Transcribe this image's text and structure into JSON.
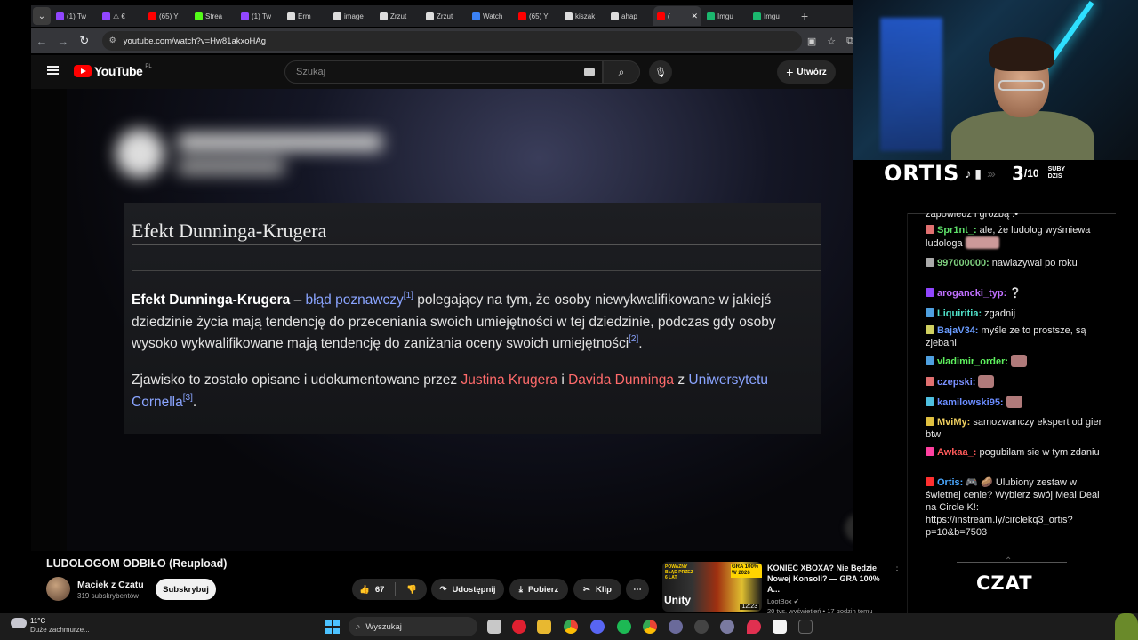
{
  "browser": {
    "tabs": [
      {
        "label": "(1) Tw",
        "color": "#9146ff"
      },
      {
        "label": "⚠ €",
        "color": "#9146ff"
      },
      {
        "label": "(65) Y",
        "color": "#ff0000"
      },
      {
        "label": "Strea",
        "color": "#53fc18"
      },
      {
        "label": "(1) Tw",
        "color": "#9146ff"
      },
      {
        "label": "Erm",
        "color": "#dddddd"
      },
      {
        "label": "image",
        "color": "#dddddd"
      },
      {
        "label": "Zrzut",
        "color": "#dddddd"
      },
      {
        "label": "Zrzut",
        "color": "#dddddd"
      },
      {
        "label": "Watch",
        "color": "#3b82f6"
      },
      {
        "label": "(65) Y",
        "color": "#ff0000"
      },
      {
        "label": "kiszak",
        "color": "#dddddd"
      },
      {
        "label": "ahap",
        "color": "#dddddd"
      },
      {
        "label": "(",
        "color": "#ff0000",
        "active": true
      },
      {
        "label": "Imgu",
        "color": "#1bb76e"
      },
      {
        "label": "Imgu",
        "color": "#1bb76e"
      }
    ],
    "url": "youtube.com/watch?v=Hw81akxoHAg"
  },
  "youtube": {
    "logo_text": "YouTube",
    "country": "PL",
    "search_placeholder": "Szukaj",
    "create_label": "Utwórz"
  },
  "video_frame": {
    "article_title": "Efekt Dunninga-Krugera",
    "p1": {
      "term": "Efekt Dunninga-Krugera",
      "dash": " – ",
      "link1": "błąd poznawczy",
      "ref1": "[1]",
      "text1": " polegający na tym, że osoby niewykwalifikowane w jakiejś dziedzinie życia mają tendencję do przeceniania swoich umiejętności w tej dziedzinie, podczas gdy osoby wysoko wykwalifikowane mają tendencję do zaniżania oceny swoich umiejętności",
      "ref2": "[2]",
      "end": "."
    },
    "p2": {
      "text1": "Zjawisko to zostało opisane i udokumentowane przez ",
      "link1": "Justina Krugera",
      "and": " i ",
      "link2": "Davida Dunninga",
      "z": " z ",
      "link3": "Uniwersytetu Cornella",
      "ref3": "[3]",
      "end": "."
    }
  },
  "video_info": {
    "title": "LUDOLOGOM ODBIŁO (Reupload)",
    "channel": "Maciek z Czatu",
    "subscribers": "319 subskrybentów",
    "subscribe_label": "Subskrybuj",
    "likes": "67",
    "share_label": "Udostępnij",
    "download_label": "Pobierz",
    "clip_label": "Klip"
  },
  "recommendation": {
    "thumb_text1": "POWAŻNY BŁĄD PRZEZ 6 LAT",
    "thumb_text2": "Unity",
    "thumb_text3": "GRA 100% W 2026",
    "duration": "12:23",
    "title": "KONIEC XBOXA? Nie Będzie Nowej Konsoli? — GRA 100% A...",
    "channel": "LootBox",
    "meta": "20 tys. wyświetleń • 17 godzin temu"
  },
  "stream": {
    "streamer": "ORTIS",
    "goal_current": "3",
    "goal_total": "/10",
    "goal_label_line1": "SUBY",
    "goal_label_line2": "DZIŚ",
    "chat_title": "CZAT",
    "chat": [
      {
        "user": "",
        "text": "zapowiedź i groźbą :•",
        "color": "#e6e6e6"
      },
      {
        "user": "Spr1nt_:",
        "text": " ale, że ludolog wyśmiewa ludologa",
        "color": "#5ee06a",
        "badge": "#e07070"
      },
      {
        "user": "997000000:",
        "text": " nawiazywal po roku",
        "color": "#7fd07f",
        "badge": "#aaaaaa"
      },
      {
        "user": "arogancki_typ:",
        "text": " ❔",
        "color": "#c070ff",
        "badge": "#9146ff"
      },
      {
        "user": "Liquiritia:",
        "text": " zgadnij",
        "color": "#4fe0c8",
        "badge": "#4fa0e0"
      },
      {
        "user": "BajaV34:",
        "text": " myśle ze to prostsze, są zjebani",
        "color": "#6a9cff",
        "badge": "#d0d060"
      },
      {
        "user": "vladimir_order:",
        "text": "",
        "color": "#5ef05e",
        "badge": "#4fa0e0"
      },
      {
        "user": "czepski:",
        "text": "",
        "color": "#7a90ff",
        "badge": "#e07070"
      },
      {
        "user": "kamilowski95:",
        "text": "",
        "color": "#6a8cff",
        "badge": "#4fc0e0"
      },
      {
        "user": "MviMy:",
        "text": " samozwanczy ekspert od gier btw",
        "color": "#f0d060",
        "badge": "#e0c040"
      },
      {
        "user": "Awkaa_:",
        "text": " pogubilam sie w tym zdaniu",
        "color": "#ff5a5a",
        "badge": "#ff40a0"
      },
      {
        "user": "Ortis:",
        "text": " 🎮 🥔 Ulubiony zestaw w świetnej cenie? Wybierz swój Meal Deal na Circle K!: https://instream.ly/circlekq3_ortis?p=10&b=7503",
        "color": "#4aa8ff",
        "badge": "#ff3030"
      }
    ]
  },
  "taskbar": {
    "temperature": "11°C",
    "weather": "Duże zachmurze...",
    "search_placeholder": "Wyszukaj"
  }
}
